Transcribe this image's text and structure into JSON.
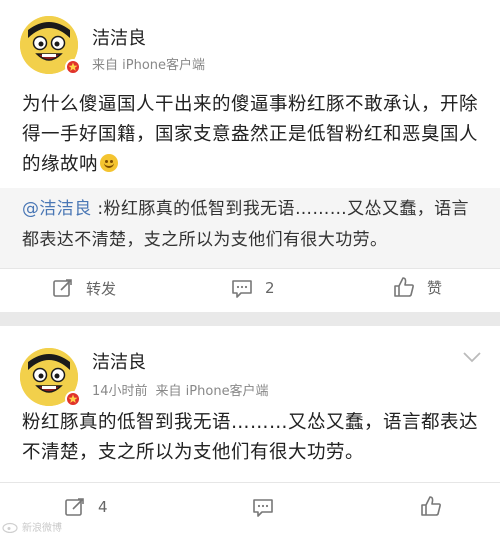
{
  "post1": {
    "username": "洁洁良",
    "source": "来自 iPhone客户端",
    "text": "为什么傻逼国人干出来的傻逼事粉红豚不敢承认，开除得一手好国籍，国家支意盎然正是低智粉红和恶臭国人的缘故呐",
    "emoji": "smile-emoji",
    "quote_mention": "@洁洁良",
    "quote_body": " :粉红豚真的低智到我无语………又怂又蠢，语言都表达不清楚，支之所以为支他们有很大功劳。",
    "actions": {
      "repost_label": "转发",
      "comment_count": "2",
      "like_label": "赞"
    }
  },
  "post2": {
    "username": "洁洁良",
    "time": "14小时前",
    "source": "来自 iPhone客户端",
    "text": "粉红豚真的低智到我无语………又怂又蠢，语言都表达不清楚，支之所以为支他们有很大功劳。",
    "actions": {
      "repost_count": "4",
      "comment_count": "",
      "like_label": ""
    }
  },
  "watermark": "新浪微博",
  "colors": {
    "mention": "#4a77b5",
    "badge": "#e0322b",
    "avatar_bg": "#f2d04b"
  }
}
